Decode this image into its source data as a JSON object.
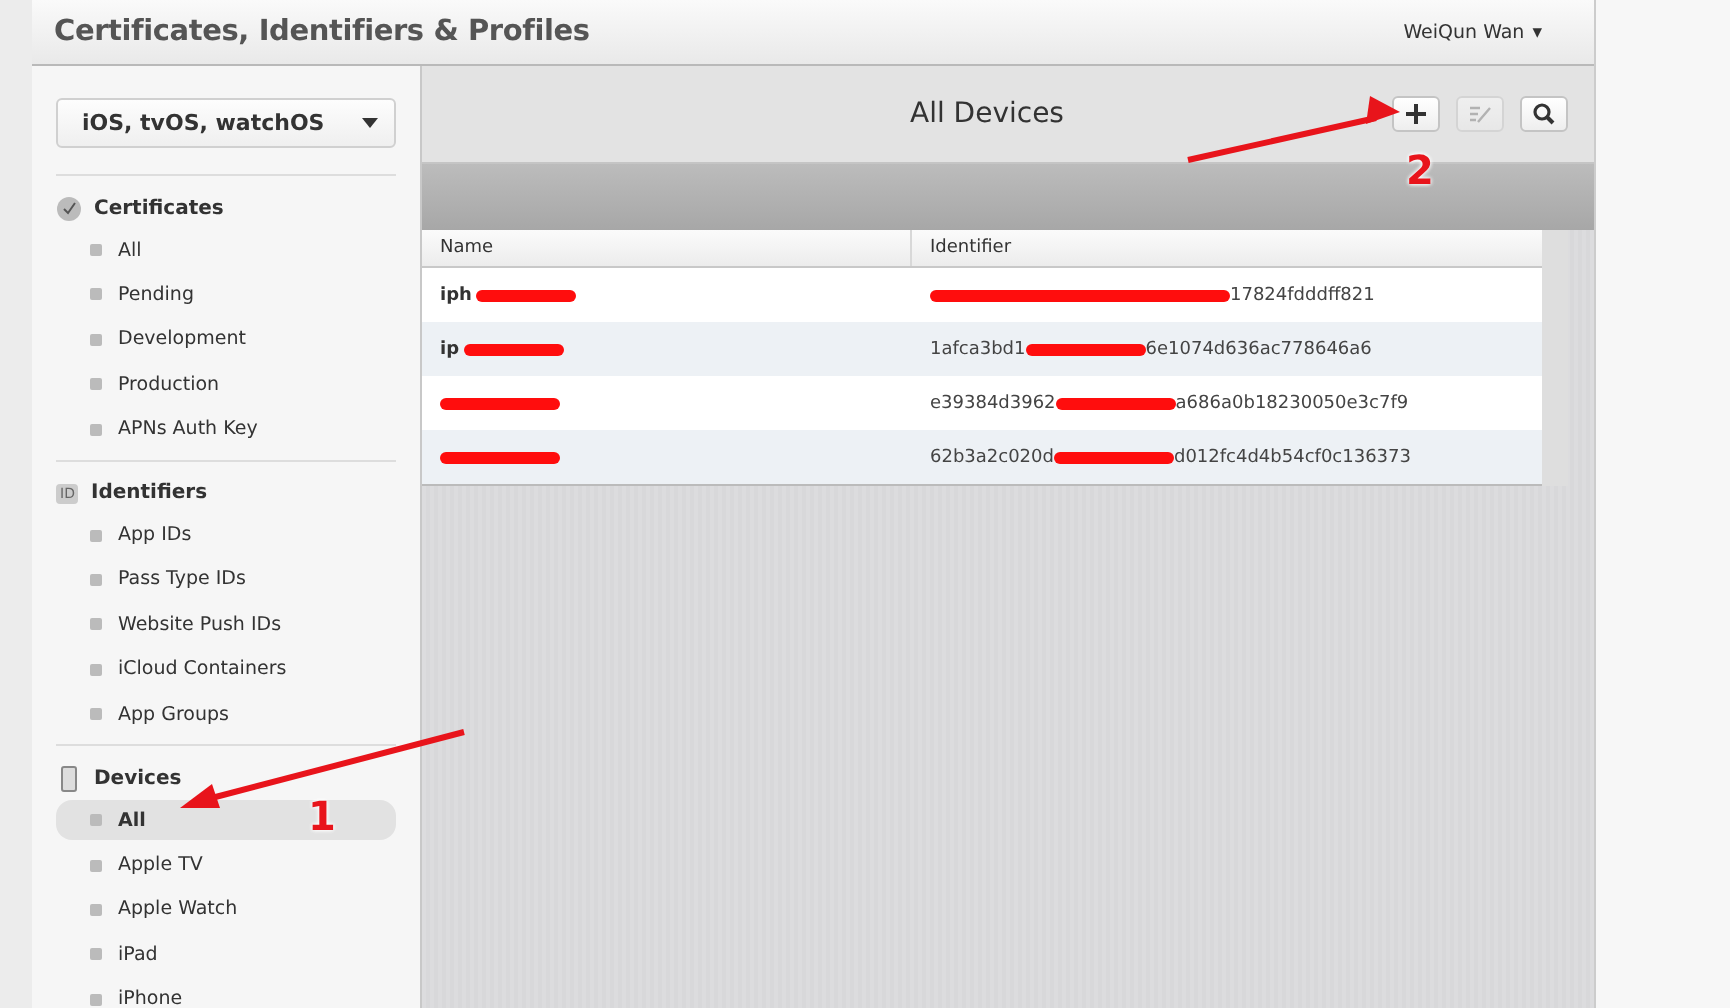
{
  "header": {
    "title": "Certificates, Identifiers & Profiles",
    "user": "WeiQun Wan",
    "user_caret": "▾"
  },
  "sidebar": {
    "platform": "iOS, tvOS, watchOS",
    "sections": [
      {
        "kind": "certificates",
        "title": "Certificates",
        "items": [
          {
            "label": "All",
            "selected": false
          },
          {
            "label": "Pending",
            "selected": false
          },
          {
            "label": "Development",
            "selected": false
          },
          {
            "label": "Production",
            "selected": false
          },
          {
            "label": "APNs Auth Key",
            "selected": false
          }
        ]
      },
      {
        "kind": "identifiers",
        "title": "Identifiers",
        "badge": "ID",
        "items": [
          {
            "label": "App IDs",
            "selected": false
          },
          {
            "label": "Pass Type IDs",
            "selected": false
          },
          {
            "label": "Website Push IDs",
            "selected": false
          },
          {
            "label": "iCloud Containers",
            "selected": false
          },
          {
            "label": "App Groups",
            "selected": false
          }
        ]
      },
      {
        "kind": "devices",
        "title": "Devices",
        "items": [
          {
            "label": "All",
            "selected": true
          },
          {
            "label": "Apple TV",
            "selected": false
          },
          {
            "label": "Apple Watch",
            "selected": false
          },
          {
            "label": "iPad",
            "selected": false
          },
          {
            "label": "iPhone",
            "selected": false
          }
        ]
      }
    ]
  },
  "main": {
    "title": "All Devices",
    "toolbar": [
      {
        "kind": "add",
        "disabled": false
      },
      {
        "kind": "edit",
        "disabled": true
      },
      {
        "kind": "search",
        "disabled": false
      }
    ],
    "table": {
      "columns": [
        "Name",
        "Identifier"
      ],
      "rows": [
        {
          "name": {
            "visible": "iph",
            "redacted": true
          },
          "identifier": {
            "end": "17824fdddff821",
            "redacted": true
          }
        },
        {
          "name": {
            "visible": "ip",
            "redacted": true
          },
          "identifier": {
            "start": "1afca3bd1",
            "end": "6e1074d636ac778646a6",
            "redacted": true
          }
        },
        {
          "name": {
            "redacted": true
          },
          "identifier": {
            "start": "e39384d3962",
            "end": "a686a0b18230050e3c7f9",
            "redacted": true
          }
        },
        {
          "name": {
            "redacted": true
          },
          "identifier": {
            "start": "62b3a2c020d",
            "end": "d012fc4d4b54cf0c136373",
            "redacted": true
          }
        }
      ]
    }
  },
  "annotations": [
    {
      "label": "1"
    },
    {
      "label": "2"
    }
  ]
}
